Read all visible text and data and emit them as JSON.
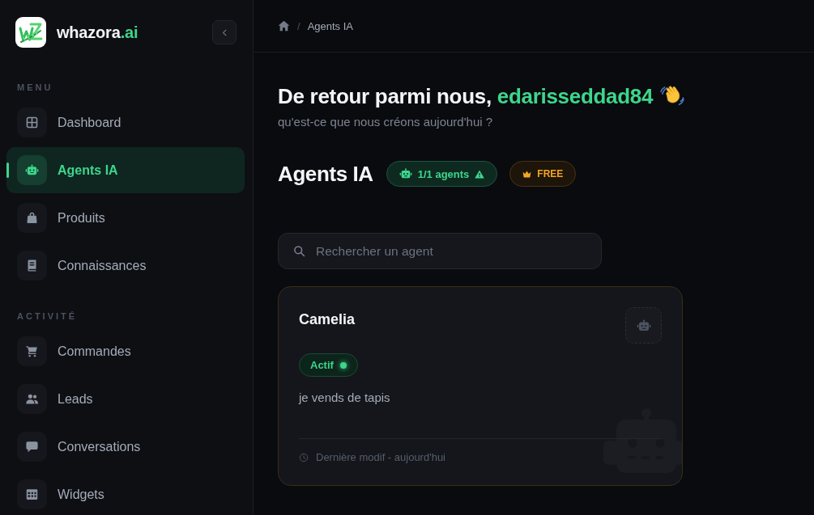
{
  "sidebar": {
    "brand": {
      "name": "whazora",
      "suffix": ".ai"
    },
    "sections": [
      {
        "title": "MENU",
        "items": [
          {
            "label": "Dashboard",
            "selected": false
          },
          {
            "label": "Agents IA",
            "selected": true
          },
          {
            "label": "Produits",
            "selected": false
          },
          {
            "label": "Connaissances",
            "selected": false
          }
        ]
      },
      {
        "title": "ACTIVITÉ",
        "items": [
          {
            "label": "Commandes",
            "selected": false
          },
          {
            "label": "Leads",
            "selected": false
          },
          {
            "label": "Conversations",
            "selected": false
          },
          {
            "label": "Widgets",
            "selected": false
          }
        ]
      }
    ]
  },
  "breadcrumb": {
    "separator": "/",
    "items": [
      "Agents IA"
    ]
  },
  "greeting": {
    "text": "De retour parmi nous,",
    "username": "edarisseddad84"
  },
  "subtitle": "qu'est-ce que nous créons aujourd'hui ?",
  "page_title": "Agents IA",
  "badges": [
    {
      "kind": "quota",
      "label": "1/1 agents",
      "limit_reached": true
    },
    {
      "kind": "plan",
      "label": "FREE"
    }
  ],
  "search": {
    "placeholder": "Rechercher un agent"
  },
  "agents": [
    {
      "name": "Camelia",
      "status": "Actif",
      "active": true,
      "description": "je vends de tapis",
      "updated": "Dernière modif - aujourd'hui"
    }
  ]
}
